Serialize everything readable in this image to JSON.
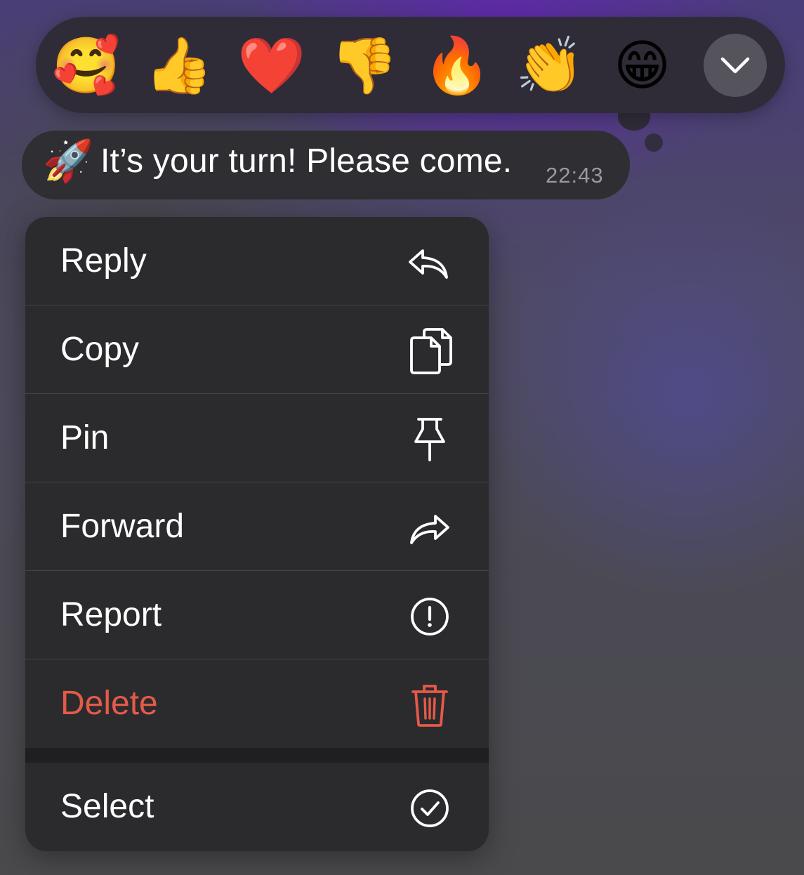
{
  "reactions": [
    {
      "emoji": "🥰",
      "name": "smiling-face-with-hearts"
    },
    {
      "emoji": "👍",
      "name": "thumbs-up"
    },
    {
      "emoji": "❤️",
      "name": "red-heart"
    },
    {
      "emoji": "👎",
      "name": "thumbs-down"
    },
    {
      "emoji": "🔥",
      "name": "fire"
    },
    {
      "emoji": "👏",
      "name": "clapping-hands"
    },
    {
      "emoji": "😁",
      "name": "beaming-face"
    }
  ],
  "expand_icon": "chevron-down-icon",
  "message": {
    "emoji": "🚀",
    "text": "It’s your turn! Please come.",
    "time": "22:43"
  },
  "menu": {
    "reply": "Reply",
    "copy": "Copy",
    "pin": "Pin",
    "forward": "Forward",
    "report": "Report",
    "delete": "Delete",
    "select": "Select"
  },
  "colors": {
    "danger": "#e55a49",
    "menu_bg": "#2b2b2d",
    "text": "#ffffff"
  }
}
